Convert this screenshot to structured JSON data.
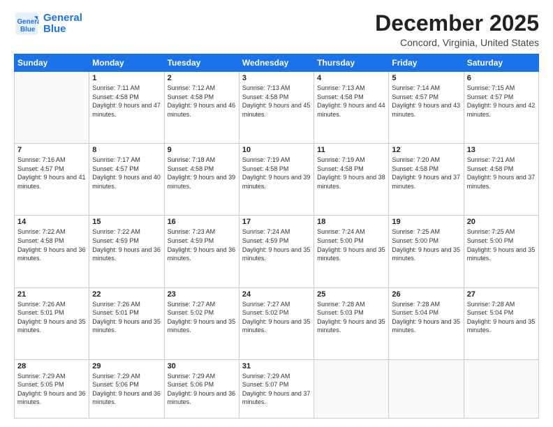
{
  "logo": {
    "line1": "General",
    "line2": "Blue"
  },
  "title": "December 2025",
  "subtitle": "Concord, Virginia, United States",
  "weekdays": [
    "Sunday",
    "Monday",
    "Tuesday",
    "Wednesday",
    "Thursday",
    "Friday",
    "Saturday"
  ],
  "weeks": [
    [
      {
        "num": "",
        "empty": true
      },
      {
        "num": "1",
        "sunrise": "7:11 AM",
        "sunset": "4:58 PM",
        "daylight": "9 hours and 47 minutes."
      },
      {
        "num": "2",
        "sunrise": "7:12 AM",
        "sunset": "4:58 PM",
        "daylight": "9 hours and 46 minutes."
      },
      {
        "num": "3",
        "sunrise": "7:13 AM",
        "sunset": "4:58 PM",
        "daylight": "9 hours and 45 minutes."
      },
      {
        "num": "4",
        "sunrise": "7:13 AM",
        "sunset": "4:58 PM",
        "daylight": "9 hours and 44 minutes."
      },
      {
        "num": "5",
        "sunrise": "7:14 AM",
        "sunset": "4:57 PM",
        "daylight": "9 hours and 43 minutes."
      },
      {
        "num": "6",
        "sunrise": "7:15 AM",
        "sunset": "4:57 PM",
        "daylight": "9 hours and 42 minutes."
      }
    ],
    [
      {
        "num": "7",
        "sunrise": "7:16 AM",
        "sunset": "4:57 PM",
        "daylight": "9 hours and 41 minutes."
      },
      {
        "num": "8",
        "sunrise": "7:17 AM",
        "sunset": "4:57 PM",
        "daylight": "9 hours and 40 minutes."
      },
      {
        "num": "9",
        "sunrise": "7:18 AM",
        "sunset": "4:58 PM",
        "daylight": "9 hours and 39 minutes."
      },
      {
        "num": "10",
        "sunrise": "7:19 AM",
        "sunset": "4:58 PM",
        "daylight": "9 hours and 39 minutes."
      },
      {
        "num": "11",
        "sunrise": "7:19 AM",
        "sunset": "4:58 PM",
        "daylight": "9 hours and 38 minutes."
      },
      {
        "num": "12",
        "sunrise": "7:20 AM",
        "sunset": "4:58 PM",
        "daylight": "9 hours and 37 minutes."
      },
      {
        "num": "13",
        "sunrise": "7:21 AM",
        "sunset": "4:58 PM",
        "daylight": "9 hours and 37 minutes."
      }
    ],
    [
      {
        "num": "14",
        "sunrise": "7:22 AM",
        "sunset": "4:58 PM",
        "daylight": "9 hours and 36 minutes."
      },
      {
        "num": "15",
        "sunrise": "7:22 AM",
        "sunset": "4:59 PM",
        "daylight": "9 hours and 36 minutes."
      },
      {
        "num": "16",
        "sunrise": "7:23 AM",
        "sunset": "4:59 PM",
        "daylight": "9 hours and 36 minutes."
      },
      {
        "num": "17",
        "sunrise": "7:24 AM",
        "sunset": "4:59 PM",
        "daylight": "9 hours and 35 minutes."
      },
      {
        "num": "18",
        "sunrise": "7:24 AM",
        "sunset": "5:00 PM",
        "daylight": "9 hours and 35 minutes."
      },
      {
        "num": "19",
        "sunrise": "7:25 AM",
        "sunset": "5:00 PM",
        "daylight": "9 hours and 35 minutes."
      },
      {
        "num": "20",
        "sunrise": "7:25 AM",
        "sunset": "5:00 PM",
        "daylight": "9 hours and 35 minutes."
      }
    ],
    [
      {
        "num": "21",
        "sunrise": "7:26 AM",
        "sunset": "5:01 PM",
        "daylight": "9 hours and 35 minutes."
      },
      {
        "num": "22",
        "sunrise": "7:26 AM",
        "sunset": "5:01 PM",
        "daylight": "9 hours and 35 minutes."
      },
      {
        "num": "23",
        "sunrise": "7:27 AM",
        "sunset": "5:02 PM",
        "daylight": "9 hours and 35 minutes."
      },
      {
        "num": "24",
        "sunrise": "7:27 AM",
        "sunset": "5:02 PM",
        "daylight": "9 hours and 35 minutes."
      },
      {
        "num": "25",
        "sunrise": "7:28 AM",
        "sunset": "5:03 PM",
        "daylight": "9 hours and 35 minutes."
      },
      {
        "num": "26",
        "sunrise": "7:28 AM",
        "sunset": "5:04 PM",
        "daylight": "9 hours and 35 minutes."
      },
      {
        "num": "27",
        "sunrise": "7:28 AM",
        "sunset": "5:04 PM",
        "daylight": "9 hours and 35 minutes."
      }
    ],
    [
      {
        "num": "28",
        "sunrise": "7:29 AM",
        "sunset": "5:05 PM",
        "daylight": "9 hours and 36 minutes."
      },
      {
        "num": "29",
        "sunrise": "7:29 AM",
        "sunset": "5:06 PM",
        "daylight": "9 hours and 36 minutes."
      },
      {
        "num": "30",
        "sunrise": "7:29 AM",
        "sunset": "5:06 PM",
        "daylight": "9 hours and 36 minutes."
      },
      {
        "num": "31",
        "sunrise": "7:29 AM",
        "sunset": "5:07 PM",
        "daylight": "9 hours and 37 minutes."
      },
      {
        "num": "",
        "empty": true
      },
      {
        "num": "",
        "empty": true
      },
      {
        "num": "",
        "empty": true
      }
    ]
  ]
}
